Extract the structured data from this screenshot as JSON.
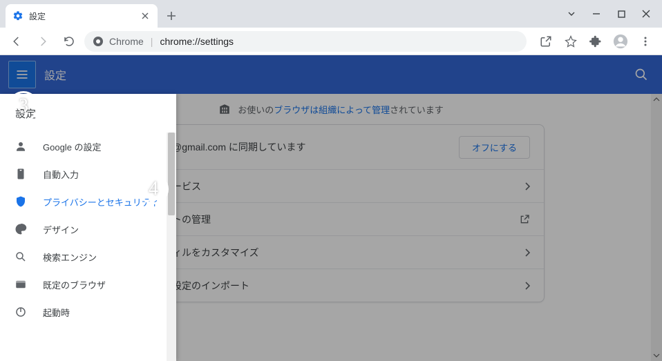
{
  "window": {
    "tab_title": "設定",
    "url_label": "Chrome",
    "url_path": "chrome://settings"
  },
  "header": {
    "title": "設定"
  },
  "banner": {
    "prefix": "お使いの",
    "link": "ブラウザは組織によって管理",
    "suffix": "されています"
  },
  "sidebar": {
    "title": "設定",
    "items": [
      {
        "label": "Google の設定"
      },
      {
        "label": "自動入力"
      },
      {
        "label": "プライバシーとセキュリティ"
      },
      {
        "label": "デザイン"
      },
      {
        "label": "検索エンジン"
      },
      {
        "label": "既定のブラウザ"
      },
      {
        "label": "起動時"
      }
    ]
  },
  "main": {
    "sync_row": "@gmail.com に同期しています",
    "turn_off": "オフにする",
    "rows": [
      "ービス",
      "トの管理",
      "ィルをカスタマイズ",
      "設定のインポート"
    ]
  },
  "annotations": {
    "step3": "3",
    "step4": "4"
  }
}
